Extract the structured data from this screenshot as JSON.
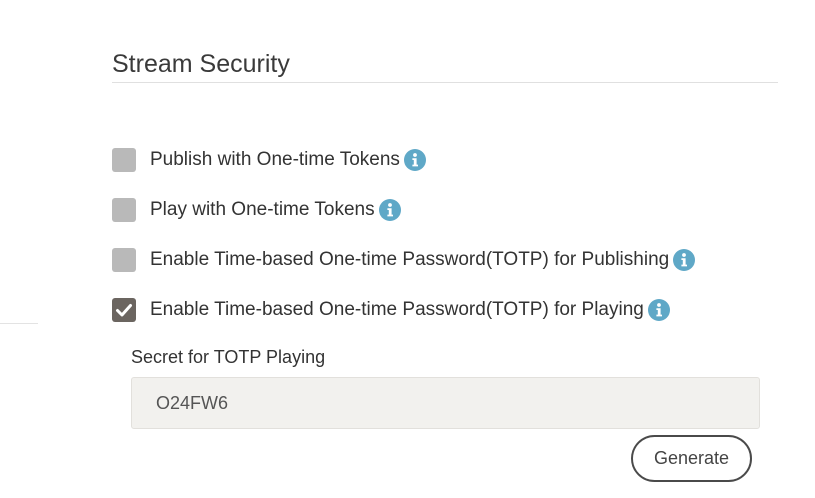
{
  "section": {
    "title": "Stream Security"
  },
  "options": [
    {
      "label": "Publish with One-time Tokens",
      "checked": false,
      "info_icon": "info-circle-icon"
    },
    {
      "label": "Play with One-time Tokens",
      "checked": false,
      "info_icon": "info-circle-icon"
    },
    {
      "label": "Enable Time-based One-time Password(TOTP) for Publishing",
      "checked": false,
      "info_icon": "info-circle-icon"
    },
    {
      "label": "Enable Time-based One-time Password(TOTP) for Playing",
      "checked": true,
      "info_icon": "info-circle-icon"
    }
  ],
  "totp_playing": {
    "field_label": "Secret for TOTP Playing",
    "secret_value": "O24FW6",
    "generate_label": "Generate"
  },
  "colors": {
    "checkbox_unchecked": "#b9b9b9",
    "checkbox_checked": "#6b6560",
    "info_icon": "#5fa8c7",
    "input_background": "#f2f1ee"
  }
}
